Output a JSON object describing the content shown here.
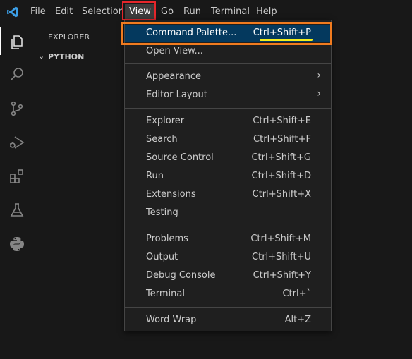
{
  "menubar": {
    "items": [
      "File",
      "Edit",
      "Selection",
      "View",
      "Go",
      "Run",
      "Terminal",
      "Help"
    ],
    "active": "View"
  },
  "sidebar": {
    "title": "EXPLORER",
    "folder": "PYTHON"
  },
  "activity_icons": [
    "explorer-icon",
    "search-icon",
    "source-control-icon",
    "run-debug-icon",
    "extensions-icon",
    "testing-icon",
    "python-icon"
  ],
  "view_menu": {
    "groups": [
      [
        {
          "label": "Command Palette...",
          "shortcut": "Ctrl+Shift+P"
        },
        {
          "label": "Open View...",
          "shortcut": ""
        }
      ],
      [
        {
          "label": "Appearance",
          "submenu": true
        },
        {
          "label": "Editor Layout",
          "submenu": true
        }
      ],
      [
        {
          "label": "Explorer",
          "shortcut": "Ctrl+Shift+E"
        },
        {
          "label": "Search",
          "shortcut": "Ctrl+Shift+F"
        },
        {
          "label": "Source Control",
          "shortcut": "Ctrl+Shift+G"
        },
        {
          "label": "Run",
          "shortcut": "Ctrl+Shift+D"
        },
        {
          "label": "Extensions",
          "shortcut": "Ctrl+Shift+X"
        },
        {
          "label": "Testing",
          "shortcut": ""
        }
      ],
      [
        {
          "label": "Problems",
          "shortcut": "Ctrl+Shift+M"
        },
        {
          "label": "Output",
          "shortcut": "Ctrl+Shift+U"
        },
        {
          "label": "Debug Console",
          "shortcut": "Ctrl+Shift+Y"
        },
        {
          "label": "Terminal",
          "shortcut": "Ctrl+`"
        }
      ],
      [
        {
          "label": "Word Wrap",
          "shortcut": "Alt+Z"
        }
      ]
    ]
  },
  "colors": {
    "accent_selected": "#04395e",
    "highlight_red": "#e5262b",
    "highlight_orange": "#f07b1f",
    "underline_yellow": "#f2ee1c",
    "vscode_blue": "#3b9ee6"
  }
}
